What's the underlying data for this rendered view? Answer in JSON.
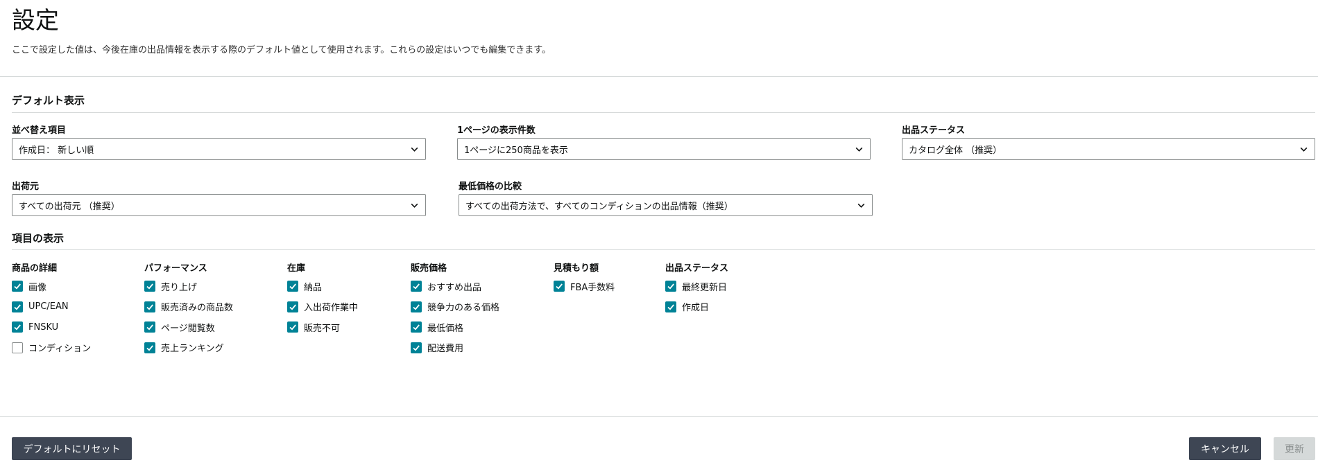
{
  "header": {
    "title": "設定",
    "description": "ここで設定した値は、今後在庫の出品情報を表示する際のデフォルト値として使用されます。これらの設定はいつでも編集できます。"
  },
  "default_view": {
    "title": "デフォルト表示",
    "sort": {
      "label": "並べ替え項目",
      "value": "作成日： 新しい順"
    },
    "per_page": {
      "label": "1ページの表示件数",
      "value": "1ページに250商品を表示"
    },
    "listing_status": {
      "label": "出品ステータス",
      "value": "カタログ全体 （推奨）"
    },
    "fulfillment": {
      "label": "出荷元",
      "value": "すべての出荷元 （推奨）"
    },
    "lowest_price": {
      "label": "最低価格の比較",
      "value": "すべての出荷方法で、すべてのコンディションの出品情報（推奨）"
    }
  },
  "columns_display": {
    "title": "項目の表示",
    "groups": [
      {
        "title": "商品の詳細",
        "items": [
          {
            "label": "画像",
            "checked": true
          },
          {
            "label": "UPC/EAN",
            "checked": true
          },
          {
            "label": "FNSKU",
            "checked": true
          },
          {
            "label": "コンディション",
            "checked": false
          }
        ]
      },
      {
        "title": "パフォーマンス",
        "items": [
          {
            "label": "売り上げ",
            "checked": true
          },
          {
            "label": "販売済みの商品数",
            "checked": true
          },
          {
            "label": "ページ閲覧数",
            "checked": true
          },
          {
            "label": "売上ランキング",
            "checked": true
          }
        ]
      },
      {
        "title": "在庫",
        "items": [
          {
            "label": "納品",
            "checked": true
          },
          {
            "label": "入出荷作業中",
            "checked": true
          },
          {
            "label": "販売不可",
            "checked": true
          }
        ]
      },
      {
        "title": "販売価格",
        "items": [
          {
            "label": "おすすめ出品",
            "checked": true
          },
          {
            "label": "競争力のある価格",
            "checked": true
          },
          {
            "label": "最低価格",
            "checked": true
          },
          {
            "label": "配送費用",
            "checked": true
          }
        ]
      },
      {
        "title": "見積もり額",
        "items": [
          {
            "label": "FBA手数料",
            "checked": true
          }
        ]
      },
      {
        "title": "出品ステータス",
        "items": [
          {
            "label": "最終更新日",
            "checked": true
          },
          {
            "label": "作成日",
            "checked": true
          }
        ]
      }
    ]
  },
  "footer": {
    "reset_label": "デフォルトにリセット",
    "cancel_label": "キャンセル",
    "update_label": "更新"
  },
  "colors": {
    "checkbox_accent": "#008296",
    "button_dark": "#3e4654",
    "button_disabled": "#d5d9d9"
  },
  "icons": {
    "dropdown": "chevron-down-icon",
    "checkbox_on": "checkmark-icon"
  }
}
